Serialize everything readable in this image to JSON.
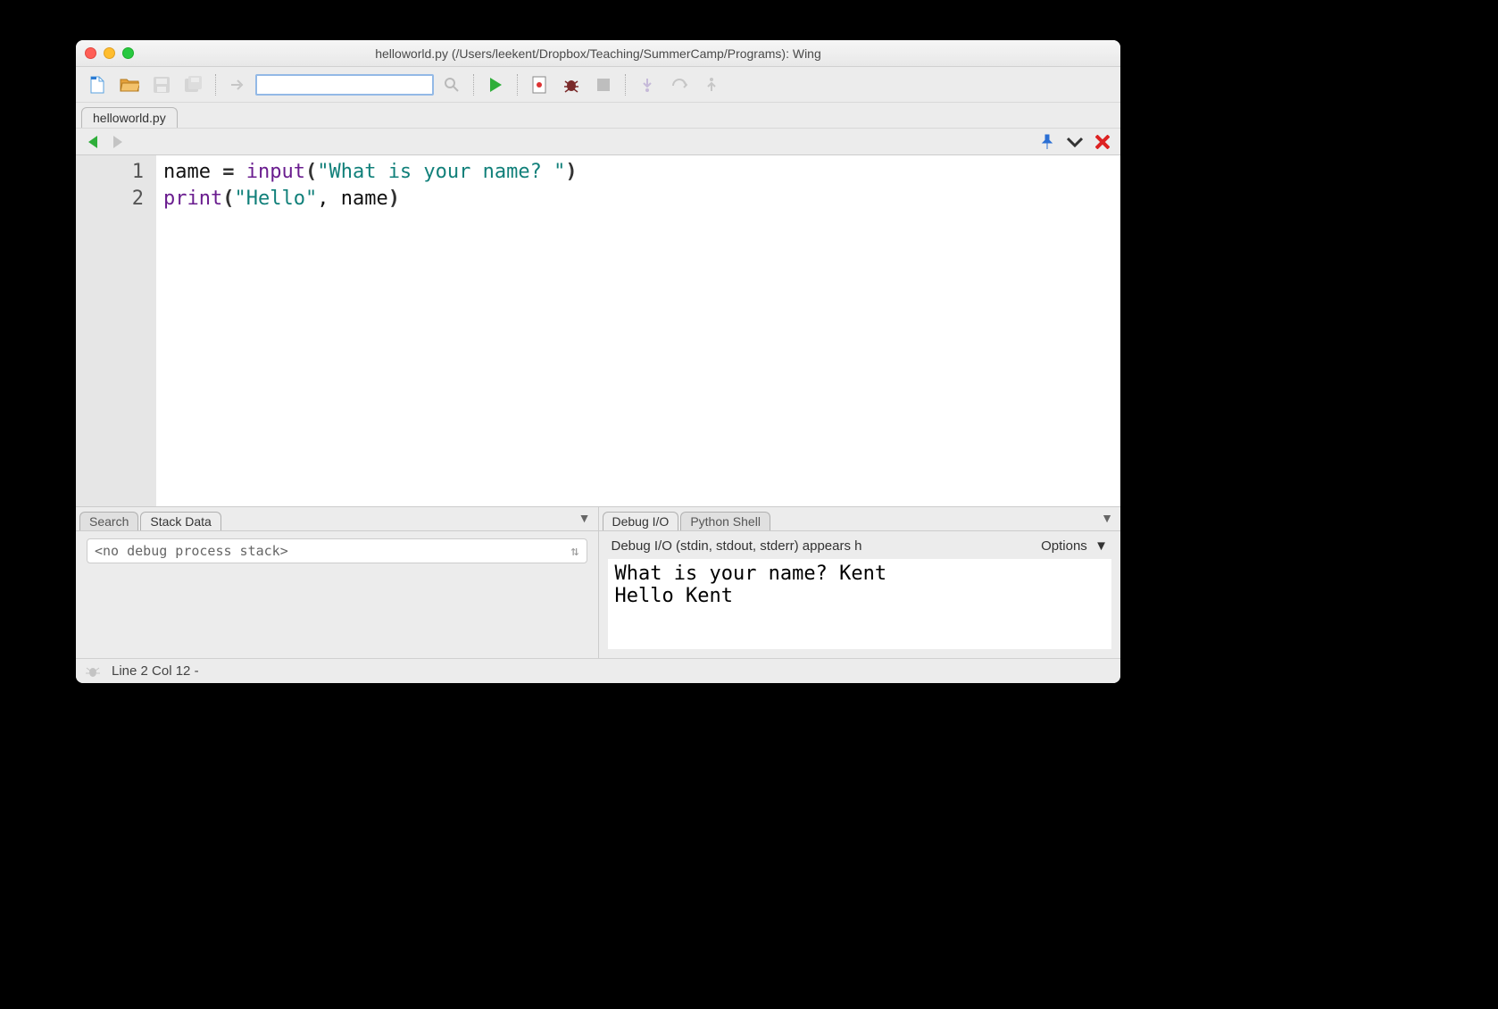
{
  "window": {
    "title": "helloworld.py (/Users/leekent/Dropbox/Teaching/SummerCamp/Programs): Wing"
  },
  "toolbar": {
    "search_value": ""
  },
  "tabs": {
    "document": "helloworld.py"
  },
  "editor": {
    "line_numbers": [
      "1",
      "2"
    ],
    "lines": [
      {
        "id": "name",
        "op": " = ",
        "fn": "input",
        "popen": "(",
        "str": "\"What is your name? \"",
        "pclose": ")"
      },
      {
        "fn": "print",
        "popen": "(",
        "str": "\"Hello\"",
        "comma": ", ",
        "id": "name",
        "pclose": ")"
      }
    ]
  },
  "left_panel": {
    "tabs": [
      "Search",
      "Stack Data"
    ],
    "active_tab": 1,
    "stack_placeholder": "<no debug process stack>"
  },
  "right_panel": {
    "tabs": [
      "Debug I/O",
      "Python Shell"
    ],
    "active_tab": 0,
    "header": "Debug I/O (stdin, stdout, stderr) appears h",
    "options_label": "Options",
    "output": "What is your name? Kent\nHello Kent"
  },
  "status": {
    "text": "Line 2 Col 12 -"
  }
}
